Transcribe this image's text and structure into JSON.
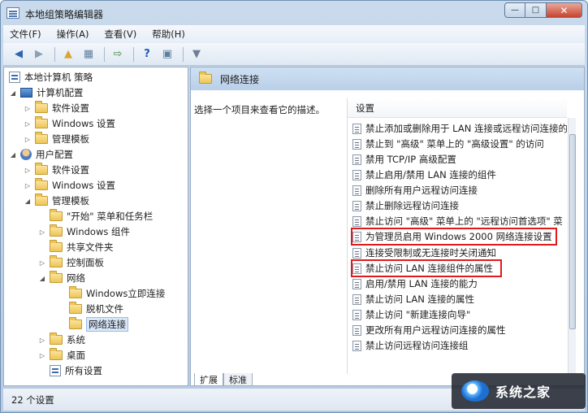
{
  "window": {
    "title": "本地组策略编辑器"
  },
  "menus": [
    "文件(F)",
    "操作(A)",
    "查看(V)",
    "帮助(H)"
  ],
  "tree": [
    {
      "label": "本地计算机 策略",
      "icon": "policy-icon",
      "arrow": ""
    },
    {
      "label": "计算机配置",
      "icon": "computer-icon",
      "arrow": "◢"
    },
    {
      "label": "软件设置",
      "icon": "folder-icon",
      "arrow": "▷"
    },
    {
      "label": "Windows 设置",
      "icon": "folder-icon",
      "arrow": "▷"
    },
    {
      "label": "管理模板",
      "icon": "folder-icon",
      "arrow": "▷"
    },
    {
      "label": "用户配置",
      "icon": "user-icon",
      "arrow": "◢"
    },
    {
      "label": "软件设置",
      "icon": "folder-icon",
      "arrow": "▷"
    },
    {
      "label": "Windows 设置",
      "icon": "folder-icon",
      "arrow": "▷"
    },
    {
      "label": "管理模板",
      "icon": "folder-icon",
      "arrow": "◢"
    },
    {
      "label": "\"开始\" 菜单和任务栏",
      "icon": "folder-icon",
      "arrow": ""
    },
    {
      "label": "Windows 组件",
      "icon": "folder-icon",
      "arrow": "▷"
    },
    {
      "label": "共享文件夹",
      "icon": "folder-icon",
      "arrow": ""
    },
    {
      "label": "控制面板",
      "icon": "folder-icon",
      "arrow": "▷"
    },
    {
      "label": "网络",
      "icon": "folder-icon",
      "arrow": "◢"
    },
    {
      "label": "Windows立即连接",
      "icon": "folder-icon",
      "arrow": ""
    },
    {
      "label": "脱机文件",
      "icon": "folder-icon",
      "arrow": ""
    },
    {
      "label": "网络连接",
      "icon": "folder-icon",
      "arrow": "",
      "selected": true
    },
    {
      "label": "系统",
      "icon": "folder-icon",
      "arrow": "▷"
    },
    {
      "label": "桌面",
      "icon": "folder-icon",
      "arrow": "▷"
    },
    {
      "label": "所有设置",
      "icon": "settings-icon",
      "arrow": ""
    }
  ],
  "right_pane": {
    "header": "网络连接",
    "description": "选择一个项目来查看它的描述。",
    "column_header": "设置",
    "settings": [
      "禁止添加或删除用于 LAN 连接或远程访问连接的组",
      "禁止到 \"高级\" 菜单上的 \"高级设置\" 的访问",
      "禁用 TCP/IP 高级配置",
      "禁止启用/禁用 LAN 连接的组件",
      "删除所有用户远程访问连接",
      "禁止删除远程访问连接",
      "禁止访问 \"高级\" 菜单上的 \"远程访问首选项\" 菜",
      "为管理员启用 Windows 2000 网络连接设置",
      "连接受限制或无连接时关闭通知",
      "禁止访问 LAN 连接组件的属性",
      "启用/禁用 LAN 连接的能力",
      "禁止访问 LAN 连接的属性",
      "禁止访问 \"新建连接向导\"",
      "更改所有用户远程访问连接的属性",
      "禁止访问远程访问连接组"
    ],
    "highlighted": [
      7,
      9
    ],
    "tabs": [
      "扩展",
      "标准"
    ]
  },
  "status": {
    "text": "22 个设置"
  },
  "watermark": {
    "text": "系统之家"
  }
}
